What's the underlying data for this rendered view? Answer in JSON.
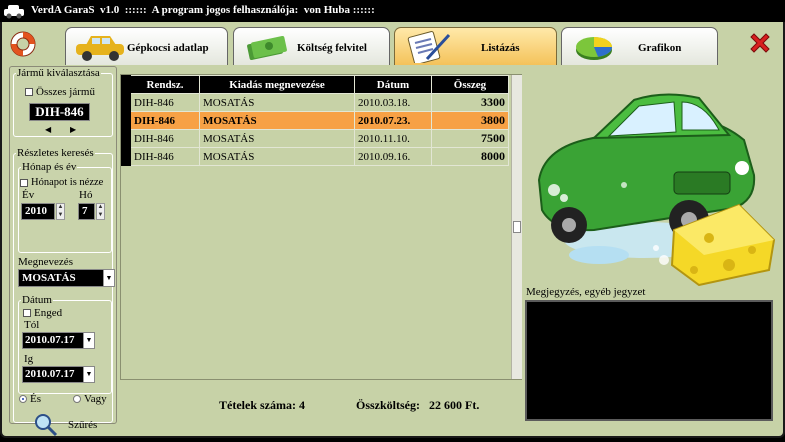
{
  "titlebar": {
    "title": "VerdA GaraS  v1.0  ::::::  A program jogos felhasználója:  von Huba ::::::"
  },
  "tabs": [
    {
      "label": "Gépkocsi adatlap",
      "icon": "car-icon",
      "active": false
    },
    {
      "label": "Költség felvitel",
      "icon": "money-icon",
      "active": false
    },
    {
      "label": "Listázás",
      "icon": "clipboard-icon",
      "active": true
    },
    {
      "label": "Grafikon",
      "icon": "pie-chart-icon",
      "active": false
    }
  ],
  "vehicle": {
    "legend": "Jármű kiválasztása",
    "all_label": "Összes jármű",
    "plate": "DIH-846"
  },
  "search": {
    "legend": "Részletes keresés",
    "month_year": {
      "legend": "Hónap és év",
      "month_check_label": "Hónapot is nézze",
      "year_label": "Év",
      "month_label": "Hó",
      "year_value": "2010",
      "month_value": "7"
    },
    "name_label": "Megnevezés",
    "name_value": "MOSATÁS",
    "date": {
      "legend": "Dátum",
      "enable_label": "Enged",
      "from_label": "Tól",
      "from_value": "2010.07.17",
      "to_label": "Ig",
      "to_value": "2010.07.17"
    },
    "and_label": "És",
    "or_label": "Vagy",
    "filter_label": "Szűrés"
  },
  "table": {
    "columns": [
      "Rendsz.",
      "Kiadás megnevezése",
      "Dátum",
      "Összeg"
    ],
    "rows": [
      [
        "DIH-846",
        "MOSATÁS",
        "2010.03.18.",
        "3300"
      ],
      [
        "DIH-846",
        "MOSATÁS",
        "2010.07.23.",
        "3800"
      ],
      [
        "DIH-846",
        "MOSATÁS",
        "2010.11.10.",
        "7500"
      ],
      [
        "DIH-846",
        "MOSATÁS",
        "2010.09.16.",
        "8000"
      ]
    ],
    "selected_row": 1
  },
  "summary": {
    "count_label": "Tételek száma:",
    "count_value": "4",
    "total_label": "Összköltség:",
    "total_value": "22 600 Ft."
  },
  "notes": {
    "label": "Megjegyzés, egyéb jegyzet",
    "value": ""
  },
  "colors": {
    "accent": "#f7a145",
    "window_bg": "#c7d2a7",
    "active_tab": "#f4c25a",
    "close": "#d81f1f"
  }
}
